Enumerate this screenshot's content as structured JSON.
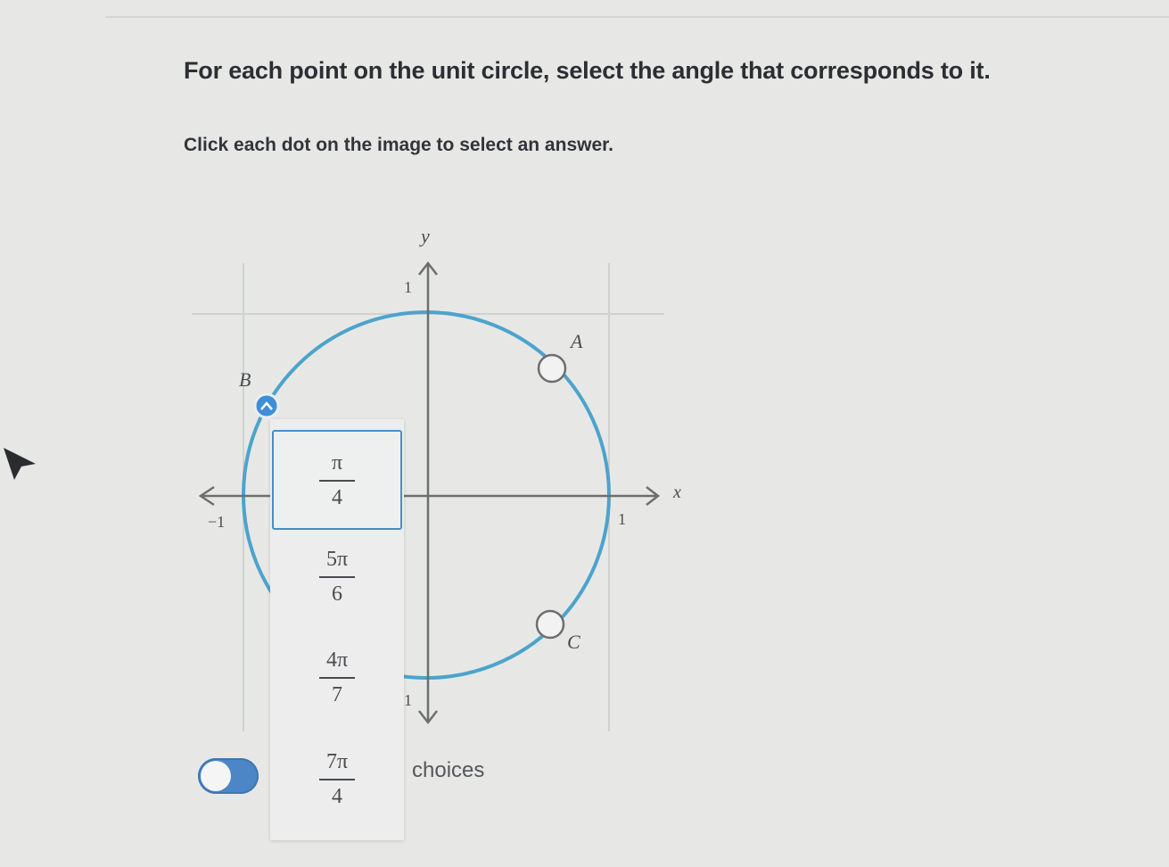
{
  "question": {
    "title": "For each point on the unit circle, select the angle that corresponds to it.",
    "instruction": "Click each dot on the image to select an answer."
  },
  "graph": {
    "axis_labels": {
      "x": "x",
      "y": "y"
    },
    "ticks": {
      "x_pos": "1",
      "x_neg": "−1",
      "y_pos": "1",
      "y_neg": "1"
    },
    "points": [
      {
        "id": "A",
        "label": "A"
      },
      {
        "id": "B",
        "label": "B"
      },
      {
        "id": "C",
        "label": "C"
      }
    ],
    "circle_color": "#4da3cc",
    "selected_point": "B"
  },
  "dropdown": {
    "options": [
      {
        "num": "π",
        "den": "4",
        "selected": true
      },
      {
        "num": "5π",
        "den": "6",
        "selected": false
      },
      {
        "num": "4π",
        "den": "7",
        "selected": false
      },
      {
        "num": "7π",
        "den": "4",
        "selected": false
      }
    ]
  },
  "footer": {
    "choices_label": "choices"
  },
  "colors": {
    "accent": "#4a8bc9",
    "toggle": "#4c86c6"
  }
}
